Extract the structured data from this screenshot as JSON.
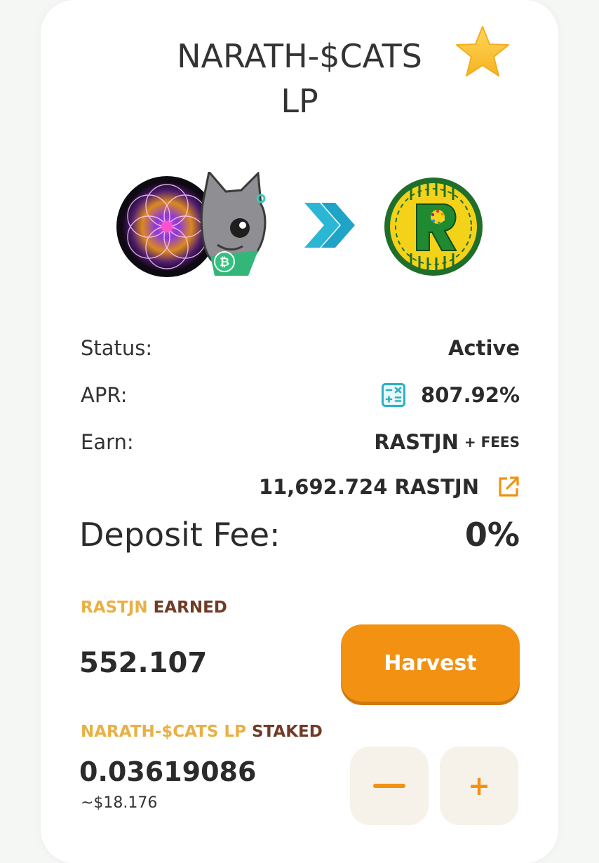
{
  "header": {
    "title_line1": "NARATH-$CATS",
    "title_line2": "LP"
  },
  "icons": {
    "favorite": "star-icon",
    "calculator": "calculator-icon",
    "external": "external-link-icon",
    "arrow": "double-chevron-right-icon"
  },
  "colors": {
    "accent": "#f29112",
    "gold": "#e8b045",
    "brown": "#6f3b26",
    "arrow": "#2bb6d6"
  },
  "details": {
    "status_label": "Status:",
    "status_value": "Active",
    "apr_label": "APR:",
    "apr_value": "807.92%",
    "earn_label": "Earn:",
    "earn_token": "RASTJN",
    "earn_fees": "+ FEES",
    "reward_amount": "11,692.724 RASTJN",
    "deposit_label": "Deposit Fee:",
    "deposit_value": "0%"
  },
  "earned": {
    "token": "RASTJN",
    "suffix": "EARNED",
    "value": "552.107",
    "harvest_label": "Harvest"
  },
  "staked": {
    "token": "NARATH-$CATS LP",
    "suffix": "STAKED",
    "value": "0.03619086",
    "usd": "~$18.176",
    "minus_label": "−",
    "plus_label": "+"
  }
}
